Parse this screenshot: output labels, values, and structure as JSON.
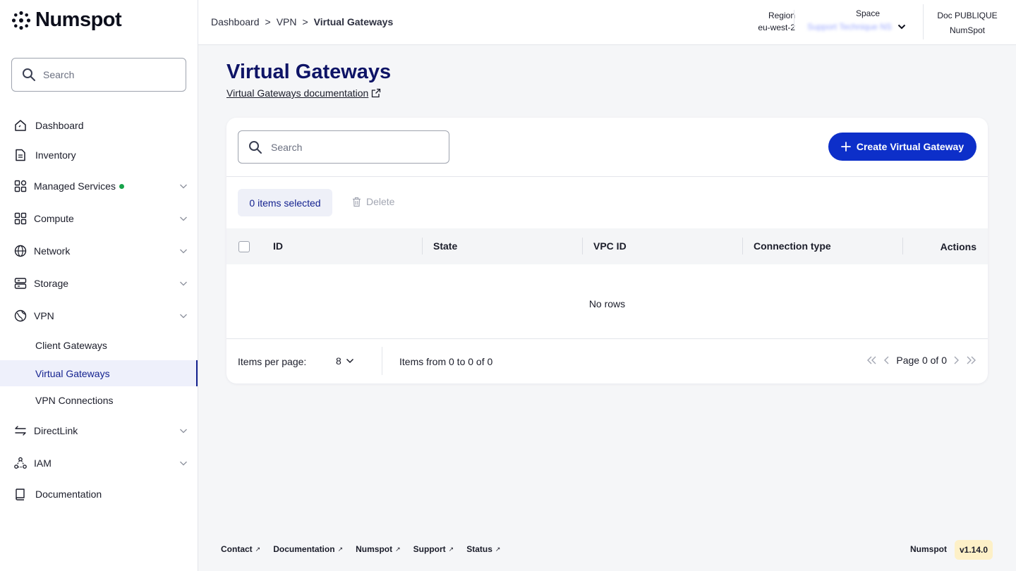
{
  "brand": {
    "name": "Numspot"
  },
  "sidebar": {
    "search_placeholder": "Search",
    "items": [
      {
        "label": "Dashboard",
        "icon": "dashboard-icon"
      },
      {
        "label": "Inventory",
        "icon": "inventory-icon"
      },
      {
        "label": "Managed Services",
        "icon": "managed-services-icon",
        "status_dot": "green"
      },
      {
        "label": "Compute",
        "icon": "compute-icon"
      },
      {
        "label": "Network",
        "icon": "globe-icon"
      },
      {
        "label": "Storage",
        "icon": "storage-icon"
      },
      {
        "label": "VPN",
        "icon": "vpn-globe-icon"
      },
      {
        "label": "DirectLink",
        "icon": "swap-arrows-icon"
      },
      {
        "label": "IAM",
        "icon": "iam-icon"
      },
      {
        "label": "Documentation",
        "icon": "book-icon"
      }
    ],
    "vpn_sub": [
      {
        "label": "Client Gateways"
      },
      {
        "label": "Virtual Gateways",
        "active": true
      },
      {
        "label": "VPN Connections"
      }
    ]
  },
  "topbar": {
    "breadcrumb": [
      "Dashboard",
      "VPN",
      "Virtual Gateways"
    ],
    "region_label": "Region",
    "region_value": "eu-west-2",
    "space_label": "Space",
    "space_value": "Support Technique NS",
    "org_label": "Doc PUBLIQUE",
    "org_value": "NumSpot"
  },
  "main": {
    "title": "Virtual Gateways",
    "doc_link": "Virtual Gateways documentation",
    "search_placeholder": "Search",
    "create_button": "Create Virtual Gateway",
    "selected_text": "0 items selected",
    "delete_label": "Delete",
    "columns": [
      "ID",
      "State",
      "VPC ID",
      "Connection type",
      "Actions"
    ],
    "empty_text": "No rows",
    "items_per_page_label": "Items per page:",
    "items_per_page_value": "8",
    "range_text": "Items from 0 to 0 of 0",
    "page_text": "Page 0 of 0"
  },
  "footer": {
    "links": [
      "Contact",
      "Documentation",
      "Numspot",
      "Support",
      "Status"
    ],
    "brand": "Numspot",
    "version": "v1.14.0"
  },
  "colors": {
    "primary": "#0d2fc9",
    "title": "#0e1466",
    "active_nav": "#14228f",
    "status_green": "#17a34a",
    "version_bg": "#fdf0c7"
  }
}
